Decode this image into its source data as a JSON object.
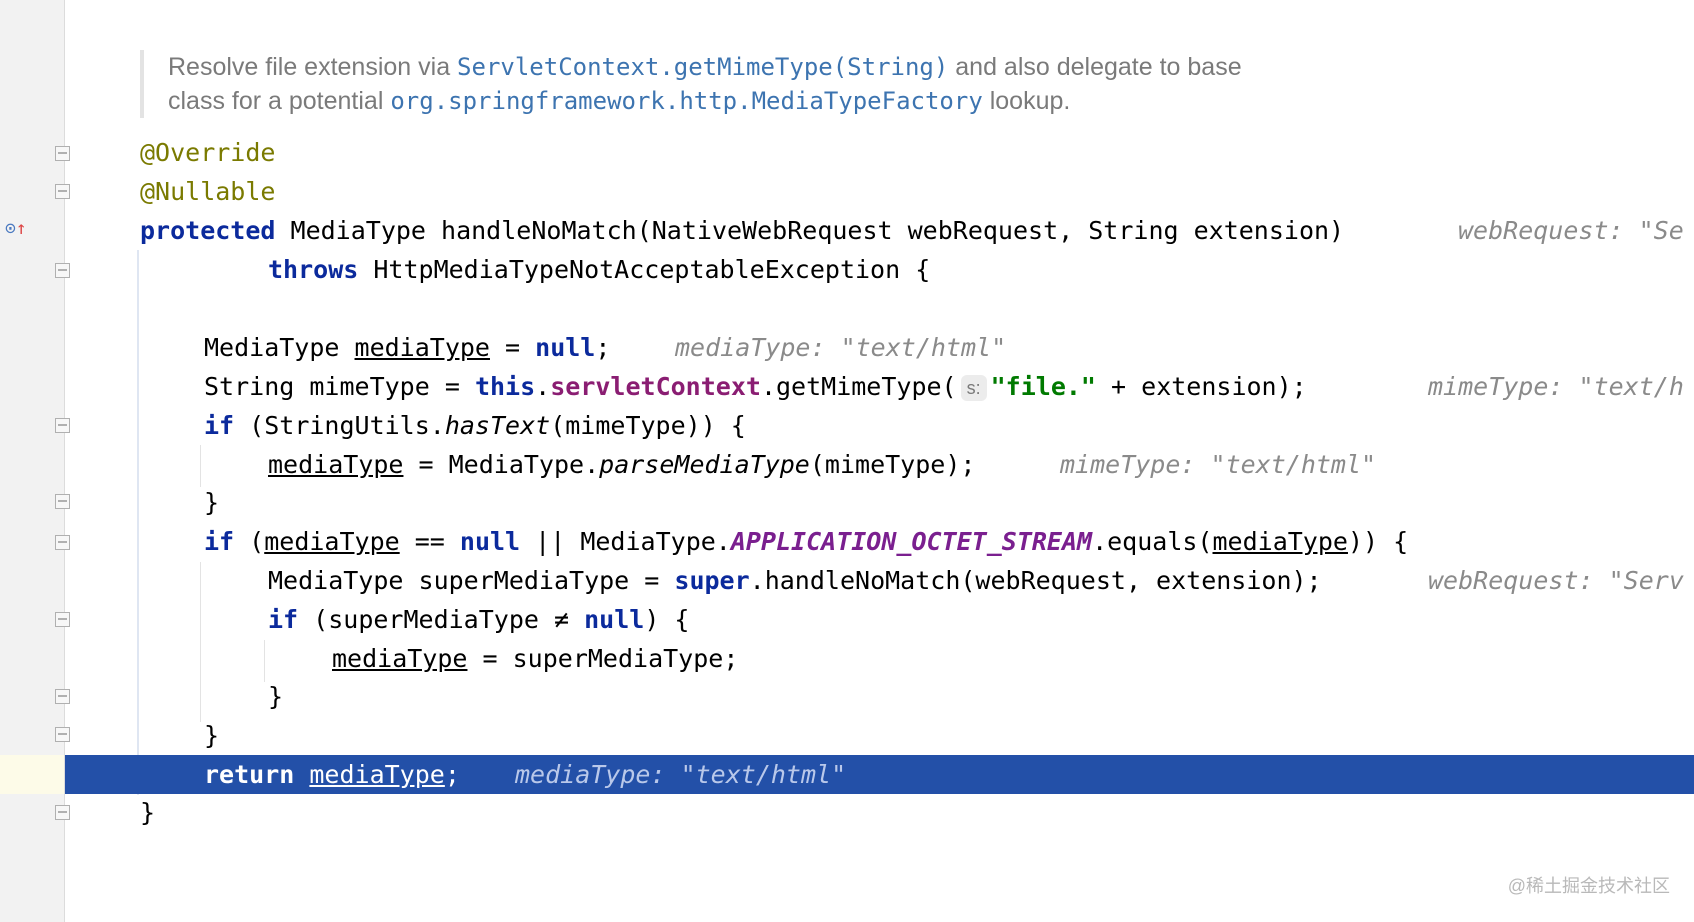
{
  "javadoc": {
    "t1": "Resolve file extension via ",
    "r1": "ServletContext.getMimeType(String)",
    "t2": " and also delegate to base",
    "t3": "class for a potential ",
    "r2": "org.springframework.http.MediaTypeFactory",
    "t4": " lookup."
  },
  "code": {
    "ann_override": "@Override",
    "ann_nullable": "@Nullable",
    "kw_protected": "protected",
    "sig_rest": " MediaType handleNoMatch(NativeWebRequest webRequest, String extension)",
    "hint_sig": "webRequest: \"Se",
    "kw_throws": "throws",
    "throws_rest": " HttpMediaTypeNotAcceptableException {",
    "l4_a": "MediaType ",
    "var_media": "mediaType",
    "l4_b": " = ",
    "kw_null": "null",
    "semi": ";",
    "hint_l4": "mediaType: \"text/html\"",
    "l5_a": "String mimeType = ",
    "kw_this": "this",
    "dot": ".",
    "fld_servlet": "servletContext",
    "l5_b": ".getMimeType(",
    "param_hint": "s:",
    "str_file": "\"file.\"",
    "l5_c": " + extension);",
    "hint_l5": "mimeType: \"text/h",
    "kw_if": "if",
    "l6_a": " (StringUtils.",
    "m_hastext": "hasText",
    "l6_b": "(mimeType)) {",
    "l7_a": " = MediaType.",
    "m_parse": "parseMediaType",
    "l7_b": "(mimeType);",
    "hint_l7": "mimeType: \"text/html\"",
    "brace_close": "}",
    "l9_a": " (",
    "l9_b": " == ",
    "l9_c": " || MediaType.",
    "const_octet": "APPLICATION_OCTET_STREAM",
    "l9_d": ".equals(",
    "l9_e": ")) {",
    "l10_a": "MediaType superMediaType = ",
    "kw_super": "super",
    "l10_b": ".handleNoMatch(webRequest, extension);",
    "hint_l10": "webRequest: \"Serv",
    "l11_a": " (superMediaType ≠ ",
    "l11_b": ") {",
    "l12_a": " = superMediaType;",
    "kw_return": "return",
    "hint_ret": "mediaType: \"text/html\""
  },
  "watermark": "@稀土掘金技术社区"
}
